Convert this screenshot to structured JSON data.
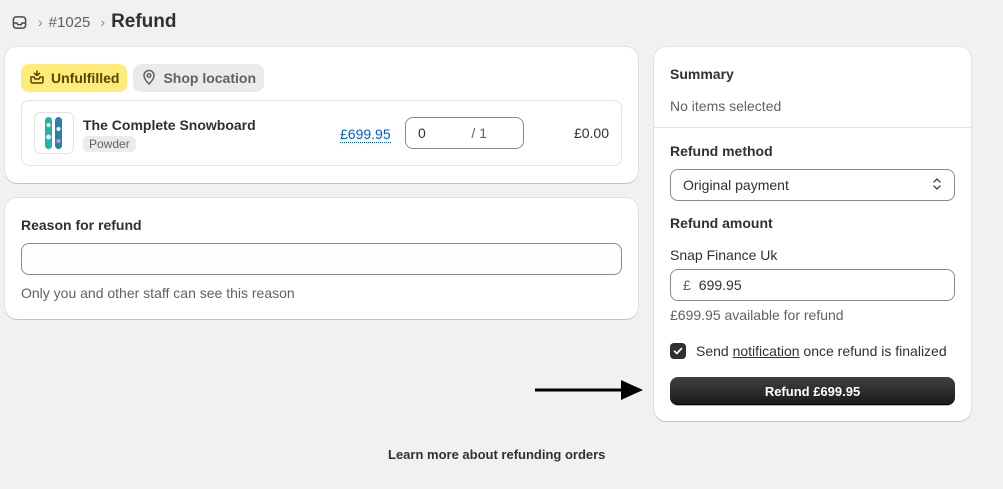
{
  "header": {
    "order_number": "#1025",
    "title": "Refund"
  },
  "fulfillment": {
    "status_label": "Unfulfilled",
    "location_label": "Shop location",
    "item": {
      "name": "The Complete Snowboard",
      "variant": "Powder",
      "unit_price": "£699.95",
      "quantity_value": "0",
      "quantity_max": "/ 1",
      "line_total": "£0.00"
    }
  },
  "reason": {
    "title": "Reason for refund",
    "input_value": "",
    "help_text": "Only you and other staff can see this reason"
  },
  "summary": {
    "title": "Summary",
    "selection_text": "No items selected",
    "refund_method_label": "Refund method",
    "refund_method_value": "Original payment",
    "refund_amount_label": "Refund amount",
    "payment_provider": "Snap Finance Uk",
    "currency_symbol": "£",
    "amount_value": "699.95",
    "available_text": "£699.95 available for refund",
    "notify_prefix": "Send",
    "notify_link": "notification",
    "notify_suffix": "once refund is finalized",
    "notify_checked": true,
    "refund_button_label": "Refund £699.95"
  },
  "footer": {
    "learn_more": "Learn more about refunding orders"
  },
  "icons": {
    "header": "inbox-icon",
    "status": "fulfillment-box-icon",
    "location": "location-pin-icon",
    "select": "select-chevrons-icon",
    "checkbox": "checkmark-icon",
    "annotation": "arrow-right-icon"
  },
  "colors": {
    "unfulfilled_badge_bg": "#ffeb78",
    "link_blue": "#005bd3",
    "primary_button": "#303030",
    "page_bg": "#f1f1f1"
  }
}
